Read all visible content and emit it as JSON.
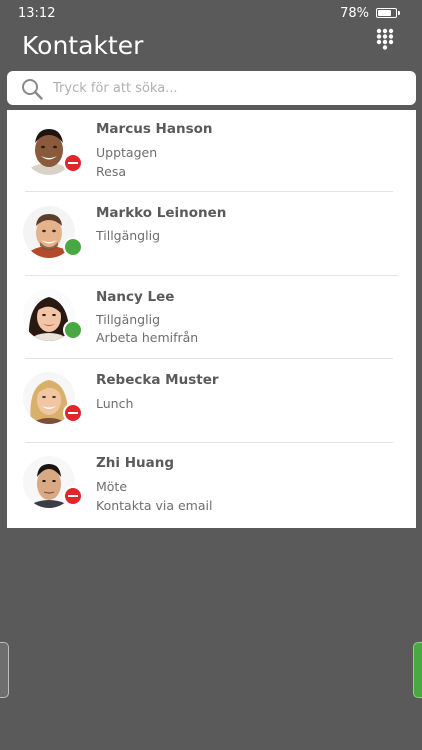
{
  "status_bar": {
    "time": "13:12",
    "battery_percent": "78%",
    "battery_level": 0.78
  },
  "header": {
    "title": "Kontakter",
    "dialpad_icon": "dialpad-icon"
  },
  "search": {
    "placeholder": "Tryck för att söka...",
    "value": "",
    "icon": "search-icon"
  },
  "presence_colors": {
    "busy": "#e0262a",
    "available": "#4aa842"
  },
  "contacts": [
    {
      "name": "Marcus Hanson",
      "status": "Upptagen",
      "note": "Resa",
      "presence": "busy"
    },
    {
      "name": "Markko Leinonen",
      "status": "Tillgänglig",
      "note": "",
      "presence": "available"
    },
    {
      "name": "Nancy Lee",
      "status": "Tillgänglig",
      "note": "Arbeta hemifrån",
      "presence": "available"
    },
    {
      "name": "Rebecka Muster",
      "status": "Lunch",
      "note": "",
      "presence": "busy"
    },
    {
      "name": "Zhi Huang",
      "status": "Möte",
      "note": "Kontakta via email",
      "presence": "busy"
    }
  ]
}
